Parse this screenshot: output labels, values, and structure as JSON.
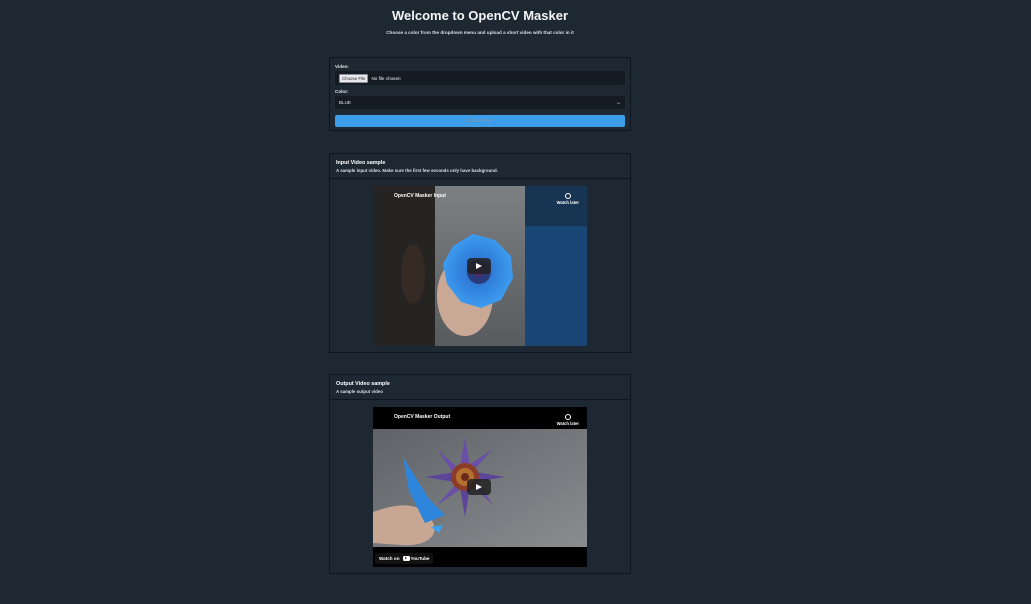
{
  "header": {
    "title": "Welcome to OpenCV Masker",
    "subtitle": "Choose a color from the dropdown menu and upload a short video with that color in it"
  },
  "upload_form": {
    "video_label": "Video:",
    "choose_file_label": "Choose File",
    "file_status": "No file chosen",
    "color_label": "Color:",
    "color_selected": "BLUE",
    "upload_button_label": "Upload Video"
  },
  "input_sample": {
    "title": "Input Video sample",
    "description": "A sample input video. Make sure the first few seconds only have background.",
    "player": {
      "video_title": "OpenCV Masker Input",
      "watch_later_label": "Watch later"
    }
  },
  "output_sample": {
    "title": "Output Video sample",
    "description": "A sample output video",
    "player": {
      "video_title": "OpenCV Masker Output",
      "watch_later_label": "Watch later",
      "watch_on_label": "Watch on",
      "youtube_label": "YouTube"
    }
  },
  "icons": {
    "chevron": "chevron-down-icon",
    "clock": "clock-icon",
    "play": "play-icon",
    "youtube": "youtube-logo-icon"
  },
  "colors": {
    "page_bg": "#1e2833",
    "accent": "#3d9de8",
    "card_border": "#0f151c"
  }
}
